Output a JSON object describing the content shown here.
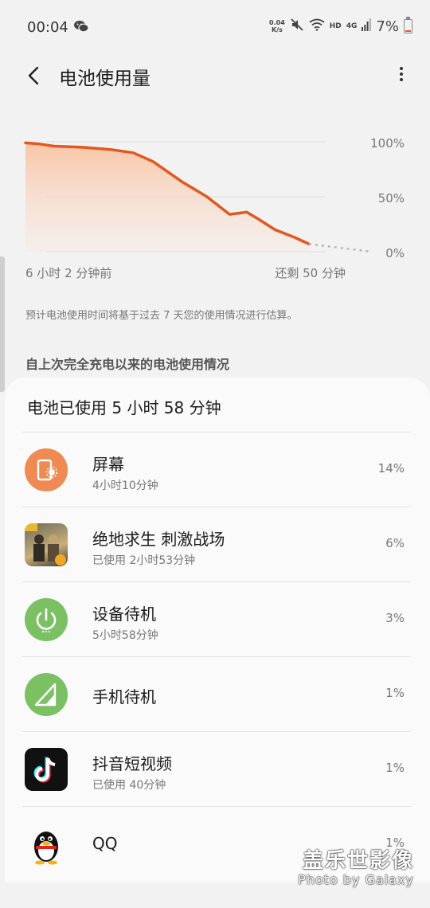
{
  "status_bar": {
    "time": "00:04",
    "speed_value": "0.04",
    "speed_unit": "K/s",
    "hd_label": "HD",
    "network_label": "4G",
    "battery_percent": "7%",
    "battery_level": 0.07,
    "icons": [
      "wechat-icon",
      "mute-icon",
      "wifi-icon",
      "signal-icon",
      "battery-icon"
    ]
  },
  "header": {
    "title": "电池使用量",
    "back_icon": "chevron-left-icon",
    "menu_icon": "more-vertical-icon"
  },
  "chart": {
    "y_labels": [
      "100%",
      "50%",
      "0%"
    ],
    "start_label": "6 小时 2 分钟前",
    "end_label": "还剩 50 分钟",
    "line_color": "#e2581e",
    "fill_color": "#f9c9ad"
  },
  "chart_data": {
    "type": "area",
    "title": "",
    "ylim": [
      0,
      100
    ],
    "y_ticks": [
      "100%",
      "50%",
      "0%"
    ],
    "x_labels": [
      "6 小时 2 分钟前",
      "还剩 50 分钟"
    ],
    "series": [
      {
        "x": [
          0,
          0.05,
          0.1,
          0.2,
          0.3,
          0.38,
          0.45,
          0.55,
          0.64,
          0.72,
          0.78,
          0.82,
          0.88,
          0.95,
          1.0
        ],
        "values": [
          99,
          98,
          96,
          95,
          93,
          90,
          82,
          64,
          50,
          34,
          36,
          30,
          20,
          13,
          7
        ]
      },
      {
        "projected": true,
        "x": [
          1.0,
          1.22
        ],
        "values": [
          7,
          0
        ]
      }
    ]
  },
  "note": "预计电池使用时间将基于过去 7 天您的使用情况进行估算。",
  "section_header": "自上次完全充电以来的电池使用情况",
  "card": {
    "summary": "电池已使用 5 小时 58 分钟",
    "items": [
      {
        "name": "屏幕",
        "sub": "4小时10分钟",
        "percent": "14%",
        "icon": "screen-icon",
        "color": "#ee8a52"
      },
      {
        "name": "绝地求生 刺激战场",
        "sub": "已使用 2小时53分钟",
        "percent": "6%",
        "icon": "pubg-app-icon"
      },
      {
        "name": "设备待机",
        "sub": "5小时58分钟",
        "percent": "3%",
        "icon": "power-icon",
        "color": "#7cc064"
      },
      {
        "name": "手机待机",
        "sub": "",
        "percent": "1%",
        "icon": "cell-signal-icon",
        "color": "#7cc064"
      },
      {
        "name": "抖音短视频",
        "sub": "已使用 40分钟",
        "percent": "1%",
        "icon": "tiktok-icon"
      },
      {
        "name": "QQ",
        "sub": "",
        "percent": "1%",
        "icon": "qq-penguin-icon"
      }
    ]
  },
  "watermark": {
    "main": "盖乐世影像",
    "sub": "Photo by Galaxy"
  }
}
